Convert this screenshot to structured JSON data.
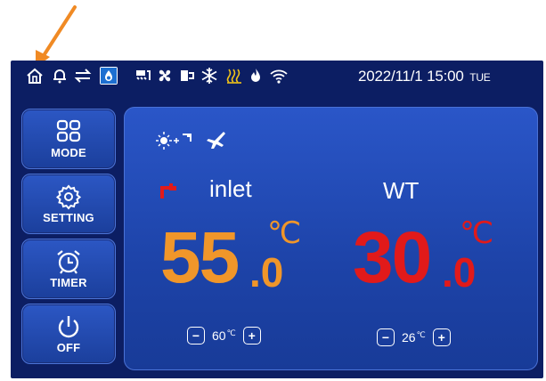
{
  "status_bar": {
    "icons": [
      "home-icon",
      "bell-icon",
      "transfer-arrows-icon",
      "water-drop-icon",
      "heater-icon",
      "fan-icon",
      "pump-icon",
      "snowflake-icon",
      "heating-coil-icon",
      "flame-icon",
      "wifi-icon"
    ],
    "date": "2022/11/1",
    "time": "15:00",
    "day": "TUE"
  },
  "sidebar": [
    {
      "label": "MODE",
      "icon": "grid-icon"
    },
    {
      "label": "SETTING",
      "icon": "gear-icon"
    },
    {
      "label": "TIMER",
      "icon": "alarm-clock-icon"
    },
    {
      "label": "OFF",
      "icon": "power-icon"
    }
  ],
  "mode_icons": [
    "sun-plus-tap-icon",
    "airplane-icon"
  ],
  "inlet": {
    "label": "inlet",
    "value_int": "55",
    "value_dec": ".0",
    "unit": "℃",
    "setpoint": "60",
    "setpoint_unit": "℃",
    "color": "#f0962a"
  },
  "water_temp": {
    "label": "WT",
    "value_int": "30",
    "value_dec": ".0",
    "unit": "℃",
    "setpoint": "26",
    "setpoint_unit": "℃",
    "color": "#e11a1a"
  },
  "colors": {
    "screen_bg": "#0c1e63",
    "panel_bg": "#2a56c8",
    "arrow": "#f08a24"
  }
}
